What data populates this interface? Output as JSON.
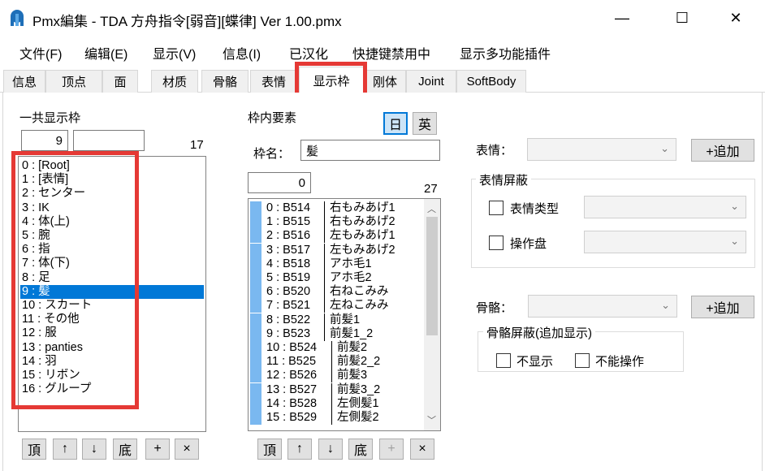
{
  "window": {
    "title": "Pmx編集 - TDA 方舟指令[弱音][蝶律] Ver 1.00.pmx",
    "minimize": "—",
    "maximize": "☐",
    "close": "✕"
  },
  "menu": [
    "文件(F)",
    "编辑(E)",
    "显示(V)",
    "信息(I)",
    "已汉化",
    "快捷键禁用中",
    "显示多功能插件"
  ],
  "tabs": [
    "信息",
    "顶点",
    "面",
    "材质",
    "骨骼",
    "表情",
    "显示枠",
    "刚体",
    "Joint",
    "SoftBody"
  ],
  "left": {
    "title": "一共显示枠",
    "index_value": "9",
    "name_value": "",
    "count": "17",
    "items": [
      "0 : [Root]",
      "1 : [表情]",
      "2 : センター",
      "3 : IK",
      "4 : 体(上)",
      "5 : 腕",
      "6 : 指",
      "7 : 体(下)",
      "8 : 足",
      "9 : 髪",
      "10 : スカート",
      "11 : その他",
      "12 : 服",
      "13 : panties",
      "14 : 羽",
      "15 : リボン",
      "16 : グループ"
    ],
    "selected_index": 9,
    "buttons": [
      "頂",
      "↑",
      "↓",
      "底",
      "+",
      "×"
    ]
  },
  "middle": {
    "title": "枠内要素",
    "lang_jp": "日",
    "lang_en": "英",
    "name_label": "枠名：",
    "name_value": "髪",
    "index_value": "0",
    "count": "27",
    "items": [
      {
        "id": "0 : B514",
        "name": "右もみあげ1"
      },
      {
        "id": "1 : B515",
        "name": "右もみあげ2"
      },
      {
        "id": "2 : B516",
        "name": "左もみあげ1"
      },
      {
        "id": "3 : B517",
        "name": "左もみあげ2"
      },
      {
        "id": "4 : B518",
        "name": "アホ毛1"
      },
      {
        "id": "5 : B519",
        "name": "アホ毛2"
      },
      {
        "id": "6 : B520",
        "name": "右ねこみみ"
      },
      {
        "id": "7 : B521",
        "name": "左ねこみみ"
      },
      {
        "id": "8 : B522",
        "name": "前髪1"
      },
      {
        "id": "9 : B523",
        "name": "前髪1_2"
      },
      {
        "id": "10 : B524",
        "name": "前髪2"
      },
      {
        "id": "11 : B525",
        "name": "前髪2_2"
      },
      {
        "id": "12 : B526",
        "name": "前髪3"
      },
      {
        "id": "13 : B527",
        "name": "前髪3_2"
      },
      {
        "id": "14 : B528",
        "name": "左側髪1"
      },
      {
        "id": "15 : B529",
        "name": "左側髪2"
      }
    ],
    "buttons": [
      "頂",
      "↑",
      "↓",
      "底",
      "+",
      "×"
    ]
  },
  "right": {
    "morph_label": "表情：",
    "morph_add": "+追加",
    "morph_mask_title": "表情屏蔽",
    "morph_type_label": "表情类型",
    "panel_label": "操作盘",
    "bone_label": "骨骼：",
    "bone_add": "+追加",
    "bone_mask_title": "骨骼屏蔽(追加显示)",
    "hide_label": "不显示",
    "no_op_label": "不能操作"
  },
  "colors": {
    "selection": "#0078d7",
    "highlight": "#e53935",
    "marker": "#7ab8f0"
  }
}
